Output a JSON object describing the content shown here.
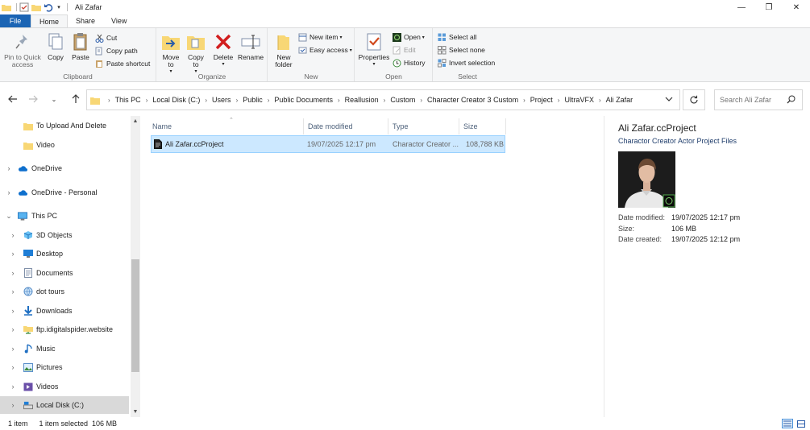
{
  "window": {
    "title": "Ali Zafar"
  },
  "tabs": [
    {
      "label": "File"
    },
    {
      "label": "Home"
    },
    {
      "label": "Share"
    },
    {
      "label": "View"
    }
  ],
  "ribbon": {
    "clipboard": {
      "label": "Clipboard",
      "pin": "Pin to Quick access",
      "copy": "Copy",
      "paste": "Paste",
      "cut": "Cut",
      "copy_path": "Copy path",
      "paste_shortcut": "Paste shortcut"
    },
    "organize": {
      "label": "Organize",
      "move_to": "Move to",
      "copy_to": "Copy to",
      "delete": "Delete",
      "rename": "Rename"
    },
    "new": {
      "label": "New",
      "new_folder": "New folder",
      "new_item": "New item",
      "easy_access": "Easy access"
    },
    "open": {
      "label": "Open",
      "properties": "Properties",
      "open": "Open",
      "edit": "Edit",
      "history": "History"
    },
    "select": {
      "label": "Select",
      "select_all": "Select all",
      "select_none": "Select none",
      "invert_selection": "Invert selection"
    }
  },
  "address": {
    "crumbs": [
      "This PC",
      "Local Disk (C:)",
      "Users",
      "Public",
      "Public Documents",
      "Reallusion",
      "Custom",
      "Character Creator 3 Custom",
      "Project",
      "UltraVFX",
      "Ali Zafar"
    ],
    "search_placeholder": "Search Ali Zafar"
  },
  "nav": {
    "items": [
      {
        "label": "To Upload And Delete",
        "icon": "folder-icon"
      },
      {
        "label": "Video",
        "icon": "folder-icon"
      },
      {
        "label": "OneDrive",
        "icon": "cloud-icon"
      },
      {
        "label": "OneDrive - Personal",
        "icon": "cloud-icon"
      },
      {
        "label": "This PC",
        "icon": "computer-icon"
      },
      {
        "label": "3D Objects",
        "icon": "cube-icon"
      },
      {
        "label": "Desktop",
        "icon": "desktop-icon"
      },
      {
        "label": "Documents",
        "icon": "document-icon"
      },
      {
        "label": "dot tours",
        "icon": "globe-icon"
      },
      {
        "label": "Downloads",
        "icon": "download-icon"
      },
      {
        "label": "ftp.idigitalspider.website",
        "icon": "network-folder-icon"
      },
      {
        "label": "Music",
        "icon": "music-icon"
      },
      {
        "label": "Pictures",
        "icon": "pictures-icon"
      },
      {
        "label": "Videos",
        "icon": "video-icon"
      },
      {
        "label": "Local Disk (C:)",
        "icon": "drive-icon"
      }
    ]
  },
  "columns": {
    "name": "Name",
    "date_modified": "Date modified",
    "type": "Type",
    "size": "Size"
  },
  "files": [
    {
      "name": "Ali Zafar.ccProject",
      "date_modified": "19/07/2025 12:17 pm",
      "type": "Charactor Creator ...",
      "size": "108,788 KB"
    }
  ],
  "details": {
    "title": "Ali Zafar.ccProject",
    "subtitle": "Charactor Creator Actor Project Files",
    "date_modified_label": "Date modified:",
    "date_modified": "19/07/2025 12:17 pm",
    "size_label": "Size:",
    "size": "106 MB",
    "date_created_label": "Date created:",
    "date_created": "19/07/2025 12:12 pm"
  },
  "status": {
    "items": "1 item",
    "selected": "1 item selected  106 MB"
  },
  "colors": {
    "file_tab": "#1a64b4",
    "selection": "#cce8ff",
    "folder": "#f8d775"
  }
}
